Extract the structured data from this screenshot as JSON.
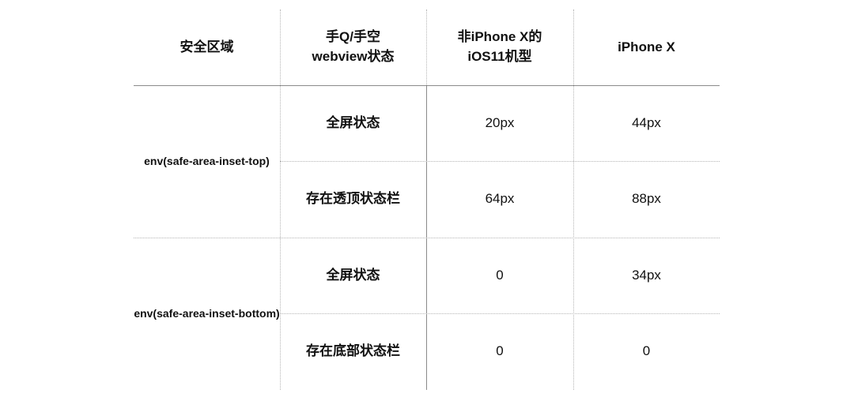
{
  "table": {
    "headers": [
      "安全区域",
      "手Q/手空\nwebview状态",
      "非iPhone X的\niOS11机型",
      "iPhone X"
    ],
    "header_lines": {
      "col2": [
        "手Q/手空",
        "webview状态"
      ],
      "col3": [
        "非iPhone X的",
        "iOS11机型"
      ]
    },
    "groups": [
      {
        "area": "env(safe-area-inset-top)",
        "rows": [
          {
            "state": "全屏状态",
            "non_iphonex_ios11": "20px",
            "iphonex": "44px"
          },
          {
            "state": "存在透顶状态栏",
            "non_iphonex_ios11": "64px",
            "iphonex": "88px"
          }
        ]
      },
      {
        "area": "env(safe-area-inset-bottom)",
        "rows": [
          {
            "state": "全屏状态",
            "non_iphonex_ios11": "0",
            "iphonex": "34px"
          },
          {
            "state": "存在底部状态栏",
            "non_iphonex_ios11": "0",
            "iphonex": "0"
          }
        ]
      }
    ]
  }
}
